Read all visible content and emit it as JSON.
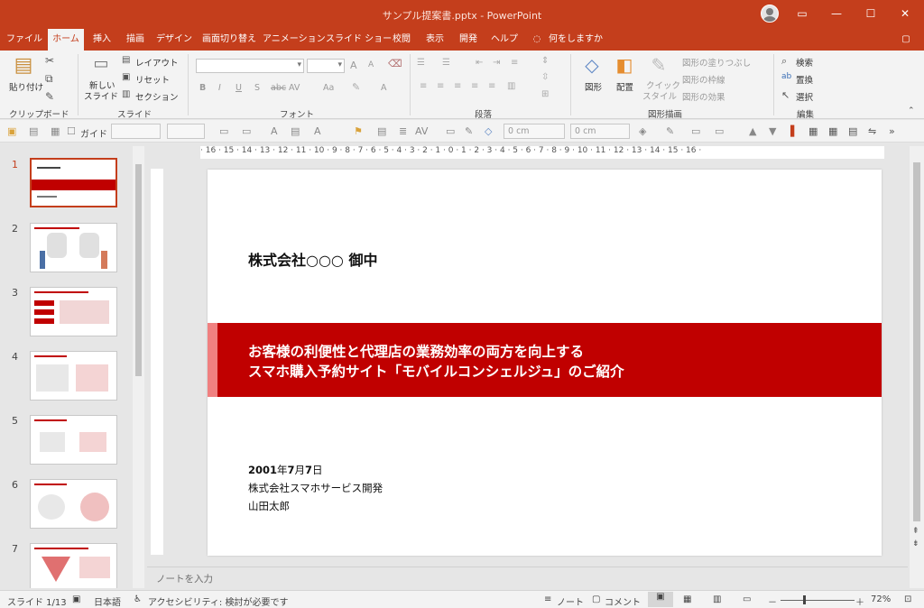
{
  "window": {
    "title": "サンプル提案書.pptx - PowerPoint",
    "minimize_icon": "minimize-icon",
    "maximize_icon": "maximize-icon",
    "close_icon": "close-icon"
  },
  "tabs": [
    {
      "label": "ファイル"
    },
    {
      "label": "ホーム"
    },
    {
      "label": "挿入"
    },
    {
      "label": "描画"
    },
    {
      "label": "デザイン"
    },
    {
      "label": "画面切り替え"
    },
    {
      "label": "アニメーション"
    },
    {
      "label": "スライド ショー"
    },
    {
      "label": "校閲"
    },
    {
      "label": "表示"
    },
    {
      "label": "開発"
    },
    {
      "label": "ヘルプ"
    },
    {
      "label": "何をしますか"
    }
  ],
  "ribbon": {
    "clipboard": {
      "paste": "貼り付け",
      "group": "クリップボード"
    },
    "slides": {
      "new_slide_1": "新しい",
      "new_slide_2": "スライド",
      "layout": "レイアウト",
      "reset": "リセット",
      "section": "セクション",
      "group": "スライド"
    },
    "font": {
      "group": "フォント",
      "bold": "B",
      "italic": "I",
      "underline": "U",
      "shadow": "S",
      "strike": "abc",
      "spacing": "AV",
      "case": "Aa",
      "color": "A",
      "grow": "A",
      "shrink": "A"
    },
    "paragraph": {
      "group": "段落"
    },
    "drawing": {
      "shapes": "図形",
      "arrange": "配置",
      "quick_style_1": "クイック",
      "quick_style_2": "スタイル",
      "fill": "図形の塗りつぶし",
      "outline": "図形の枠線",
      "effect": "図形の効果",
      "group": "図形描画"
    },
    "editing": {
      "find": "検索",
      "replace": "置換",
      "select": "選択",
      "group": "編集"
    }
  },
  "qat": {
    "guide": "ガイド",
    "width": "0 cm",
    "height": "0 cm"
  },
  "thumbnails": [
    {
      "num": "1"
    },
    {
      "num": "2"
    },
    {
      "num": "3"
    },
    {
      "num": "4"
    },
    {
      "num": "5"
    },
    {
      "num": "6"
    },
    {
      "num": "7"
    }
  ],
  "ruler": {
    "h_ticks": "· 16 · 15 · 14 · 13 · 12 · 11 · 10 · 9 · 8 · 7 · 6 · 5 · 4 · 3 · 2 · 1 · 0 · 1 · 2 · 3 · 4 · 5 · 6 · 7 · 8 · 9 · 10 · 11 · 12 · 13 · 14 · 15 · 16 ·"
  },
  "slide": {
    "addressee": "株式会社○○○ 御中",
    "title_line1": "お客様の利便性と代理店の業務効率の両方を向上する",
    "title_line2": "スマホ購入予約サイト「モバイルコンシェルジュ」のご紹介",
    "date_year": "2001",
    "date_y": "年",
    "date_month": "7",
    "date_m": "月",
    "date_day": "7",
    "date_d": "日",
    "company": "株式会社スマホサービス開発",
    "person": "山田太郎"
  },
  "notes": {
    "placeholder": "ノートを入力"
  },
  "status": {
    "slide_pos": "スライド 1/13",
    "language": "日本語",
    "accessibility": "アクセシビリティ: 検討が必要です",
    "notes": "ノート",
    "comments": "コメント",
    "zoom": "72%",
    "minus": "－",
    "plus": "＋"
  },
  "colors": {
    "accent": "#c43e1c",
    "band": "#c00000",
    "band_edge": "#f08080"
  }
}
